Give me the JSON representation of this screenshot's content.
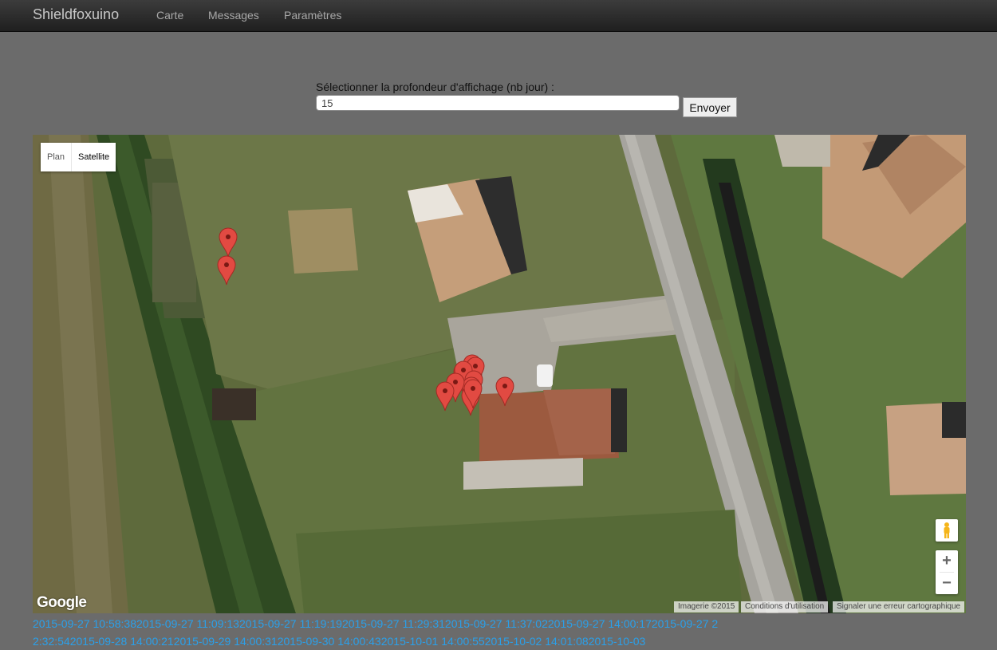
{
  "nav": {
    "brand": "Shieldfoxuino",
    "items": [
      {
        "label": "Carte"
      },
      {
        "label": "Messages"
      },
      {
        "label": "Paramètres"
      }
    ]
  },
  "form": {
    "label": "Sélectionner la profondeur d'affichage (nb jour) :",
    "input_value": "15",
    "submit_label": "Envoyer"
  },
  "map": {
    "type_controls": {
      "plan_label": "Plan",
      "satellite_label": "Satellite",
      "selected": "Satellite"
    },
    "zoom_in_label": "+",
    "zoom_out_label": "−",
    "google_logo": "Google",
    "attribution": {
      "imagery": "Imagerie ©2015",
      "terms": "Conditions d'utilisation",
      "report": "Signaler une erreur cartographique"
    },
    "marker_color": "#e24a42",
    "marker_count": 15
  },
  "log": {
    "entries": [
      "2015-09-27 10:58:38",
      "2015-09-27 11:09:13",
      "2015-09-27 11:19:19",
      "2015-09-27 11:29:31",
      "2015-09-27 11:37:02",
      "2015-09-27 14:00:17",
      "2015-09-27 22:32:54",
      "2015-09-28 14:00:21",
      "2015-09-29 14:00:31",
      "2015-09-30 14:00:43",
      "2015-10-01 14:00:55",
      "2015-10-02 14:01:08",
      "2015-10-03"
    ]
  }
}
